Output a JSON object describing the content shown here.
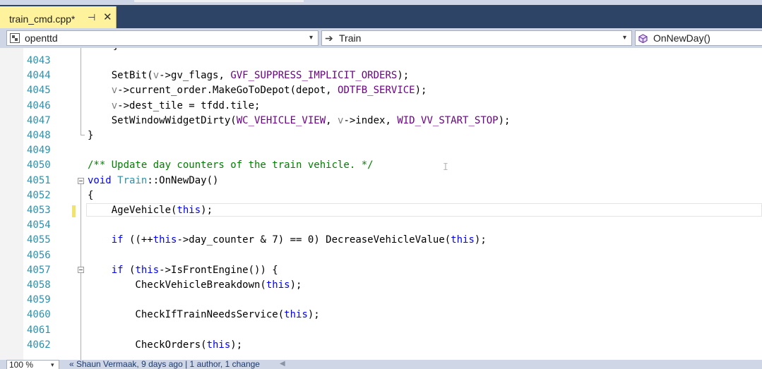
{
  "tab": {
    "title": "train_cmd.cpp*",
    "pin_glyph": "⊣",
    "close_glyph": "✕"
  },
  "nav": {
    "project": "openttd",
    "scope": "Train",
    "scope_glyph": "➔",
    "member": "OnNewDay()",
    "dropdown_glyph": "▾"
  },
  "editor": {
    "partial_line_text": "}",
    "lines": [
      {
        "n": "4043",
        "t": []
      },
      {
        "n": "4044",
        "t": [
          [
            "    SetBit(",
            ""
          ],
          [
            "v",
            "pv"
          ],
          [
            "->gv_flags, ",
            ""
          ],
          [
            "GVF_SUPPRESS_IMPLICIT_ORDERS",
            "mac"
          ],
          [
            ");",
            ""
          ]
        ]
      },
      {
        "n": "4045",
        "t": [
          [
            "    ",
            ""
          ],
          [
            "v",
            "pv"
          ],
          [
            "->current_order.MakeGoToDepot(depot, ",
            ""
          ],
          [
            "ODTFB_SERVICE",
            "mac"
          ],
          [
            ");",
            ""
          ]
        ]
      },
      {
        "n": "4046",
        "t": [
          [
            "    ",
            ""
          ],
          [
            "v",
            "pv"
          ],
          [
            "->dest_tile = tfdd.tile;",
            ""
          ]
        ]
      },
      {
        "n": "4047",
        "t": [
          [
            "    SetWindowWidgetDirty(",
            ""
          ],
          [
            "WC_VEHICLE_VIEW",
            "mac"
          ],
          [
            ", ",
            ""
          ],
          [
            "v",
            "pv"
          ],
          [
            "->index, ",
            ""
          ],
          [
            "WID_VV_START_STOP",
            "mac"
          ],
          [
            ");",
            ""
          ]
        ]
      },
      {
        "n": "4048",
        "t": [
          [
            "}",
            ""
          ]
        ]
      },
      {
        "n": "4049",
        "t": []
      },
      {
        "n": "4050",
        "t": [
          [
            "/** Update day counters of the train vehicle. */",
            "cmt"
          ]
        ]
      },
      {
        "n": "4051",
        "t": [
          [
            "void",
            "kw"
          ],
          [
            " ",
            ""
          ],
          [
            "Train",
            "ty"
          ],
          [
            "::OnNewDay()",
            ""
          ]
        ]
      },
      {
        "n": "4052",
        "t": [
          [
            "{",
            ""
          ]
        ]
      },
      {
        "n": "4053",
        "t": [
          [
            "    AgeVehicle(",
            ""
          ],
          [
            "this",
            "kw"
          ],
          [
            ");",
            ""
          ]
        ]
      },
      {
        "n": "4054",
        "t": []
      },
      {
        "n": "4055",
        "t": [
          [
            "    ",
            ""
          ],
          [
            "if",
            "kw"
          ],
          [
            " ((++",
            ""
          ],
          [
            "this",
            "kw"
          ],
          [
            "->day_counter & 7) == 0) DecreaseVehicleValue(",
            ""
          ],
          [
            "this",
            "kw"
          ],
          [
            ");",
            ""
          ]
        ]
      },
      {
        "n": "4056",
        "t": []
      },
      {
        "n": "4057",
        "t": [
          [
            "    ",
            ""
          ],
          [
            "if",
            "kw"
          ],
          [
            " (",
            ""
          ],
          [
            "this",
            "kw"
          ],
          [
            "->IsFrontEngine()) {",
            ""
          ]
        ]
      },
      {
        "n": "4058",
        "t": [
          [
            "        CheckVehicleBreakdown(",
            ""
          ],
          [
            "this",
            "kw"
          ],
          [
            ");",
            ""
          ]
        ]
      },
      {
        "n": "4059",
        "t": []
      },
      {
        "n": "4060",
        "t": [
          [
            "        CheckIfTrainNeedsService(",
            ""
          ],
          [
            "this",
            "kw"
          ],
          [
            ");",
            ""
          ]
        ]
      },
      {
        "n": "4061",
        "t": []
      },
      {
        "n": "4062",
        "t": [
          [
            "        CheckOrders(",
            ""
          ],
          [
            "this",
            "kw"
          ],
          [
            ");",
            ""
          ]
        ]
      }
    ]
  },
  "status": {
    "zoom": "100 %",
    "zoom_glyph": "▾",
    "codelens": "« Shaun Vermaak, 9 days ago | 1 author, 1 change",
    "scroll_glyph": "◀"
  }
}
